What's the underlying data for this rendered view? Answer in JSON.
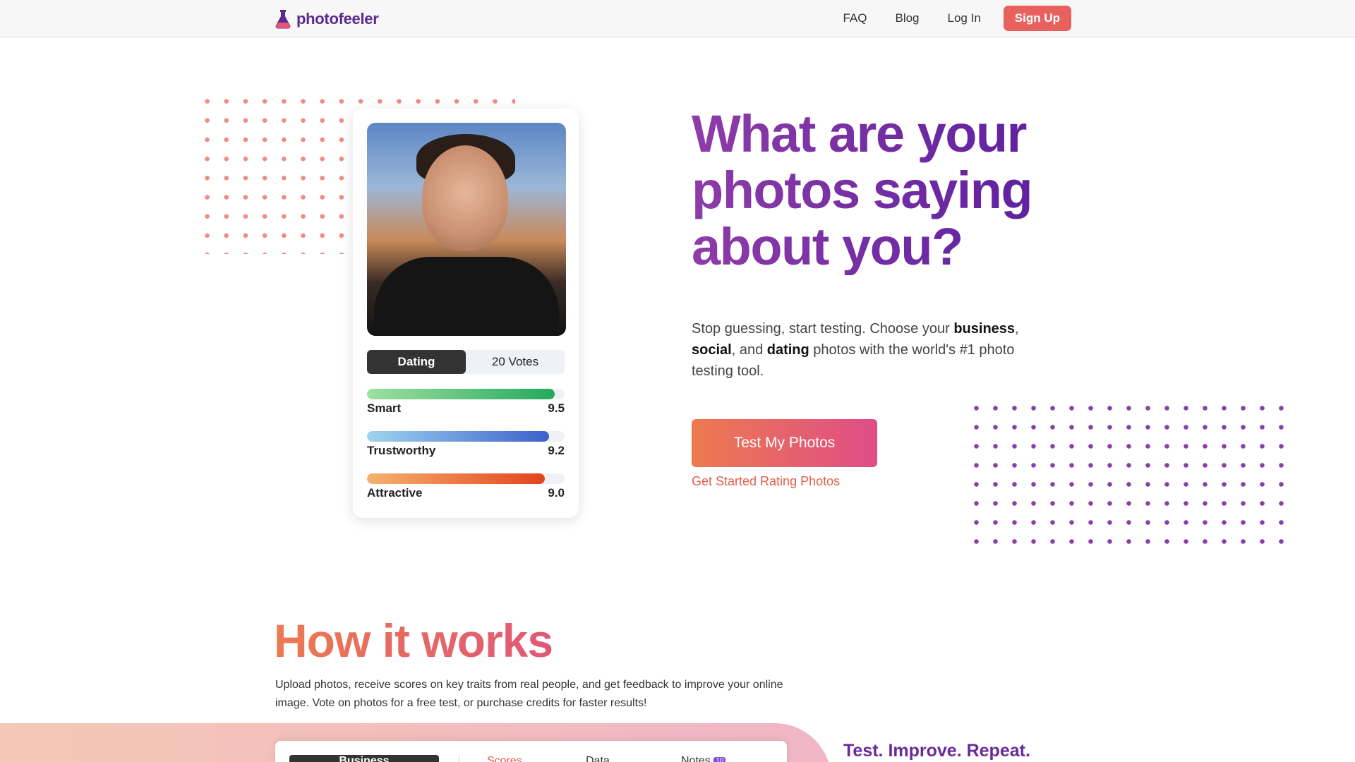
{
  "brand": {
    "name": "photofeeler",
    "logo_icon": "flask-icon",
    "color": "#5a2a8c"
  },
  "nav": {
    "faq": "FAQ",
    "blog": "Blog",
    "login": "Log In",
    "signup": "Sign Up",
    "signup_color": "#e8615e"
  },
  "card": {
    "tabs": [
      "Dating",
      "20 Votes"
    ],
    "traits": [
      {
        "label": "Smart",
        "score": "9.5",
        "fill": 0.95
      },
      {
        "label": "Trustworthy",
        "score": "9.2",
        "fill": 0.92
      },
      {
        "label": "Attractive",
        "score": "9.0",
        "fill": 0.9
      }
    ]
  },
  "hero": {
    "headline": "What are your photos saying about you?",
    "sub_parts": [
      "Stop guessing, start testing. Choose your ",
      "business",
      ", ",
      "social",
      ", and ",
      "dating",
      " photos with the world's #1 photo testing tool."
    ],
    "cta": "Test My Photos",
    "cta_link": "Get Started Rating Photos"
  },
  "how": {
    "title": "How it works",
    "text": "Upload photos, receive scores on key traits from real people, and get feedback to improve your online image. Vote on photos for a free test, or purchase credits for faster results!",
    "tabs": [
      "Business",
      "Scores",
      "Data",
      "Notes"
    ],
    "notes_badge": "10",
    "tagline": "Test. Improve. Repeat."
  }
}
